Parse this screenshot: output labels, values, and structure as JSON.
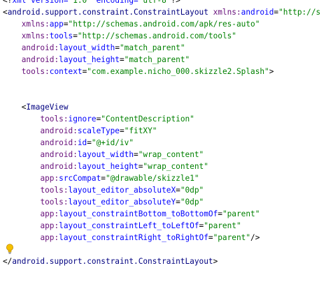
{
  "editor": {
    "colors": {
      "tag": "#000080",
      "namespace": "#660e7a",
      "attribute": "#0000ff",
      "value": "#008000",
      "punctuation": "#000000"
    },
    "lines": [
      [
        {
          "t": "<?",
          "k": "punc"
        },
        {
          "t": "xml version=",
          "k": "attr"
        },
        {
          "t": "\"1.0\"",
          "k": "val"
        },
        {
          "t": " encoding=",
          "k": "attr"
        },
        {
          "t": "\"utf-8\"",
          "k": "val"
        },
        {
          "t": "?>",
          "k": "punc"
        }
      ],
      [
        {
          "t": "<",
          "k": "punc"
        },
        {
          "t": "android.support.constraint.ConstraintLayout",
          "k": "tag"
        },
        {
          "t": " ",
          "k": "punc"
        },
        {
          "t": "xmlns:",
          "k": "ns"
        },
        {
          "t": "android",
          "k": "attr"
        },
        {
          "t": "=",
          "k": "punc"
        },
        {
          "t": "\"http://s",
          "k": "val"
        }
      ],
      [
        {
          "t": "    ",
          "k": "punc"
        },
        {
          "t": "xmlns:",
          "k": "ns"
        },
        {
          "t": "app",
          "k": "attr"
        },
        {
          "t": "=",
          "k": "punc"
        },
        {
          "t": "\"http://schemas.android.com/apk/res-auto\"",
          "k": "val"
        }
      ],
      [
        {
          "t": "    ",
          "k": "punc"
        },
        {
          "t": "xmlns:",
          "k": "ns"
        },
        {
          "t": "tools",
          "k": "attr"
        },
        {
          "t": "=",
          "k": "punc"
        },
        {
          "t": "\"http://schemas.android.com/tools\"",
          "k": "val"
        }
      ],
      [
        {
          "t": "    ",
          "k": "punc"
        },
        {
          "t": "android:",
          "k": "ns"
        },
        {
          "t": "layout_width",
          "k": "attr"
        },
        {
          "t": "=",
          "k": "punc"
        },
        {
          "t": "\"match_parent\"",
          "k": "val"
        }
      ],
      [
        {
          "t": "    ",
          "k": "punc"
        },
        {
          "t": "android:",
          "k": "ns"
        },
        {
          "t": "layout_height",
          "k": "attr"
        },
        {
          "t": "=",
          "k": "punc"
        },
        {
          "t": "\"match_parent\"",
          "k": "val"
        }
      ],
      [
        {
          "t": "    ",
          "k": "punc"
        },
        {
          "t": "tools:",
          "k": "ns"
        },
        {
          "t": "context",
          "k": "attr"
        },
        {
          "t": "=",
          "k": "punc"
        },
        {
          "t": "\"com.example.nicho_000.skizzle2.Splash\"",
          "k": "val"
        },
        {
          "t": ">",
          "k": "punc"
        }
      ],
      [],
      [],
      [
        {
          "t": "    <",
          "k": "punc"
        },
        {
          "t": "ImageView",
          "k": "tag"
        }
      ],
      [
        {
          "t": "        ",
          "k": "punc"
        },
        {
          "t": "tools:",
          "k": "ns"
        },
        {
          "t": "ignore",
          "k": "attr"
        },
        {
          "t": "=",
          "k": "punc"
        },
        {
          "t": "\"ContentDescription\"",
          "k": "val"
        }
      ],
      [
        {
          "t": "        ",
          "k": "punc"
        },
        {
          "t": "android:",
          "k": "ns"
        },
        {
          "t": "scaleType",
          "k": "attr"
        },
        {
          "t": "=",
          "k": "punc"
        },
        {
          "t": "\"fitXY\"",
          "k": "val"
        }
      ],
      [
        {
          "t": "        ",
          "k": "punc"
        },
        {
          "t": "android:",
          "k": "ns"
        },
        {
          "t": "id",
          "k": "attr"
        },
        {
          "t": "=",
          "k": "punc"
        },
        {
          "t": "\"@+id/iv\"",
          "k": "val"
        }
      ],
      [
        {
          "t": "        ",
          "k": "punc"
        },
        {
          "t": "android:",
          "k": "ns"
        },
        {
          "t": "layout_width",
          "k": "attr"
        },
        {
          "t": "=",
          "k": "punc"
        },
        {
          "t": "\"wrap_content\"",
          "k": "val"
        }
      ],
      [
        {
          "t": "        ",
          "k": "punc"
        },
        {
          "t": "android:",
          "k": "ns"
        },
        {
          "t": "layout_height",
          "k": "attr"
        },
        {
          "t": "=",
          "k": "punc"
        },
        {
          "t": "\"wrap_content\"",
          "k": "val"
        }
      ],
      [
        {
          "t": "        ",
          "k": "punc"
        },
        {
          "t": "app:",
          "k": "ns"
        },
        {
          "t": "srcCompat",
          "k": "attr"
        },
        {
          "t": "=",
          "k": "punc"
        },
        {
          "t": "\"@drawable/skizzle1\"",
          "k": "val"
        }
      ],
      [
        {
          "t": "        ",
          "k": "punc"
        },
        {
          "t": "tools:",
          "k": "ns"
        },
        {
          "t": "layout_editor_absoluteX",
          "k": "attr"
        },
        {
          "t": "=",
          "k": "punc"
        },
        {
          "t": "\"0dp\"",
          "k": "val"
        }
      ],
      [
        {
          "t": "        ",
          "k": "punc"
        },
        {
          "t": "tools:",
          "k": "ns"
        },
        {
          "t": "layout_editor_absoluteY",
          "k": "attr"
        },
        {
          "t": "=",
          "k": "punc"
        },
        {
          "t": "\"0dp\"",
          "k": "val"
        }
      ],
      [
        {
          "t": "        ",
          "k": "punc"
        },
        {
          "t": "app:",
          "k": "ns"
        },
        {
          "t": "layout_constraintBottom_toBottomOf",
          "k": "attr"
        },
        {
          "t": "=",
          "k": "punc"
        },
        {
          "t": "\"parent\"",
          "k": "val"
        }
      ],
      [
        {
          "t": "        ",
          "k": "punc"
        },
        {
          "t": "app:",
          "k": "ns"
        },
        {
          "t": "layout_constraintLeft_toLeftOf",
          "k": "attr"
        },
        {
          "t": "=",
          "k": "punc"
        },
        {
          "t": "\"parent\"",
          "k": "val"
        }
      ],
      [
        {
          "t": "        ",
          "k": "punc"
        },
        {
          "t": "app:",
          "k": "ns"
        },
        {
          "t": "layout_constraintRight_toRightOf",
          "k": "attr"
        },
        {
          "t": "=",
          "k": "punc"
        },
        {
          "t": "\"parent\"",
          "k": "val"
        },
        {
          "t": "/>",
          "k": "punc"
        }
      ],
      [],
      [
        {
          "t": "</",
          "k": "punc"
        },
        {
          "t": "android.support.constraint.ConstraintLayout",
          "k": "tag"
        },
        {
          "t": ">",
          "k": "punc"
        }
      ]
    ],
    "intention_icon": "lightbulb-icon"
  }
}
